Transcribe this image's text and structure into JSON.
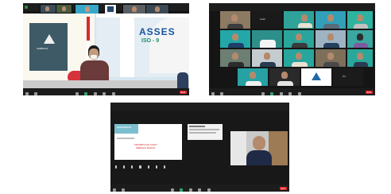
{
  "screen1": {
    "banner_line1": "ASSES",
    "banner_line2": "ISO - 9",
    "logo_text": "LEMBAGA",
    "end_label": "End"
  },
  "screen2": {
    "end_label": "End"
  },
  "screen3": {
    "slide_heading": "Audit Report",
    "slide_red_line1": "KESIMPULAN AUDIT",
    "slide_red_line2": "SEBAGAI BAHAN",
    "end_label": "End"
  },
  "colors": {
    "gallery_bg": "#151515",
    "tile_green": "#2fa39a",
    "slide_red": "#cf2a2a",
    "end_red": "#e0262d"
  }
}
